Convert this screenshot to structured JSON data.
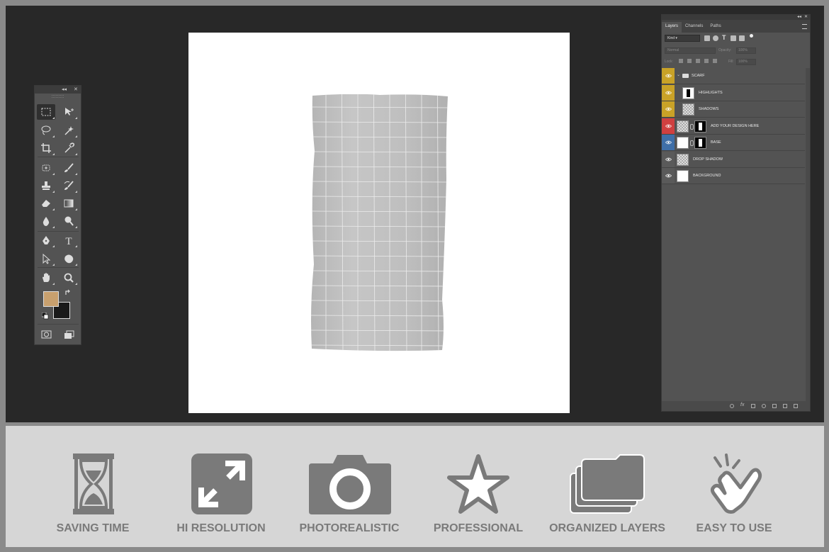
{
  "tools_panel": {
    "collapse_glyph": "◂◂",
    "close_glyph": "✕",
    "foreground_color": "#c8a06e",
    "background_color": "#1a1a1a",
    "tools": [
      {
        "name": "rectangular-marquee-icon"
      },
      {
        "name": "move-icon"
      },
      {
        "name": "lasso-icon"
      },
      {
        "name": "magic-wand-icon"
      },
      {
        "name": "crop-icon"
      },
      {
        "name": "eyedropper-icon"
      },
      {
        "name": "spot-healing-icon"
      },
      {
        "name": "brush-icon"
      },
      {
        "name": "clone-stamp-icon"
      },
      {
        "name": "history-brush-icon"
      },
      {
        "name": "eraser-icon"
      },
      {
        "name": "gradient-icon"
      },
      {
        "name": "blur-icon"
      },
      {
        "name": "dodge-icon"
      },
      {
        "name": "pen-icon"
      },
      {
        "name": "type-icon",
        "glyph": "T"
      },
      {
        "name": "path-selection-icon"
      },
      {
        "name": "custom-shape-icon"
      },
      {
        "name": "hand-icon"
      },
      {
        "name": "zoom-icon"
      },
      {
        "name": "quick-mask-icon"
      },
      {
        "name": "screen-mode-icon"
      }
    ]
  },
  "layers_panel": {
    "tabs": [
      "Layers",
      "Channels",
      "Paths"
    ],
    "active_tab": "Layers",
    "filter_kind": "Kind",
    "blend_mode": "Normal",
    "opacity_label": "Opacity:",
    "opacity_value": "100%",
    "lock_label": "Lock:",
    "fill_label": "Fill:",
    "fill_value": "100%",
    "layers": [
      {
        "name": "SCARF",
        "type": "group",
        "label_color": "#c9a227"
      },
      {
        "name": "HIGHLIGHTS",
        "type": "layer",
        "label_color": "#c9a227"
      },
      {
        "name": "SHADOWS",
        "type": "layer",
        "label_color": "#c9a227"
      },
      {
        "name": "ADD YOUR DESIGN HERE",
        "type": "smart-object",
        "label_color": "#d04040"
      },
      {
        "name": "BASE",
        "type": "layer",
        "label_color": "#3f6fa8"
      },
      {
        "name": "DROP SHADOW",
        "type": "layer",
        "label_color": "#5a5a5a"
      },
      {
        "name": "BACKGROUND",
        "type": "layer",
        "label_color": "#5a5a5a"
      }
    ]
  },
  "features": [
    {
      "label": "SAVING TIME",
      "icon": "hourglass-icon"
    },
    {
      "label": "HI RESOLUTION",
      "icon": "expand-arrows-icon"
    },
    {
      "label": "PHOTOREALISTIC",
      "icon": "camera-icon"
    },
    {
      "label": "PROFESSIONAL",
      "icon": "star-icon"
    },
    {
      "label": "ORGANIZED LAYERS",
      "icon": "folders-icon"
    },
    {
      "label": "EASY TO USE",
      "icon": "tapping-hand-icon"
    }
  ],
  "colors": {
    "workspace": "#282828",
    "panel": "#535353",
    "feature_bar": "#d6d6d6",
    "feature_icon": "#7a7a7a"
  }
}
